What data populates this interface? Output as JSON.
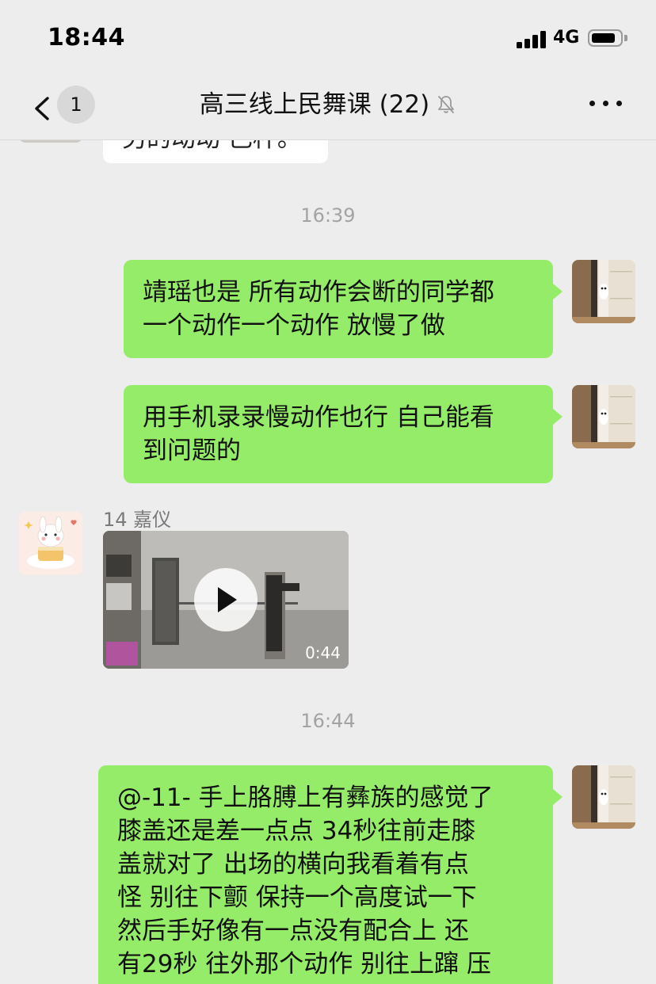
{
  "status_bar": {
    "time": "18:44",
    "network": "4G",
    "battery_level": 0.85
  },
  "nav": {
    "back_count": "1",
    "title": "高三线上民舞课 (22)",
    "mute_icon": "bell-slash-icon",
    "more_icon": "ellipsis-icon"
  },
  "messages": {
    "partial_top_text": "另的动动 己杯。",
    "ts1": "16:39",
    "m1_line1": "靖瑶也是 所有动作会断的同学都",
    "m1_line2": "一个动作一个动作 放慢了做",
    "m2_line1": "用手机录录慢动作也行 自己能看",
    "m2_line2": "到问题的",
    "sender_name": "14 嘉仪",
    "video_duration": "0:44",
    "ts2": "16:44",
    "m3_lines": [
      "@-11- 手上胳膊上有彝族的感觉了",
      "膝盖还是差一点点 34秒往前走膝",
      "盖就对了 出场的横向我看着有点",
      "怪 别往下颤 保持一个高度试一下",
      "然后手好像有一点没有配合上 还",
      "有29秒 往外那个动作 别往上蹿 压"
    ]
  },
  "colors": {
    "background": "#ededed",
    "bubble_green": "#95ec69",
    "bubble_white": "#ffffff",
    "timestamp": "#a3a3a3"
  }
}
